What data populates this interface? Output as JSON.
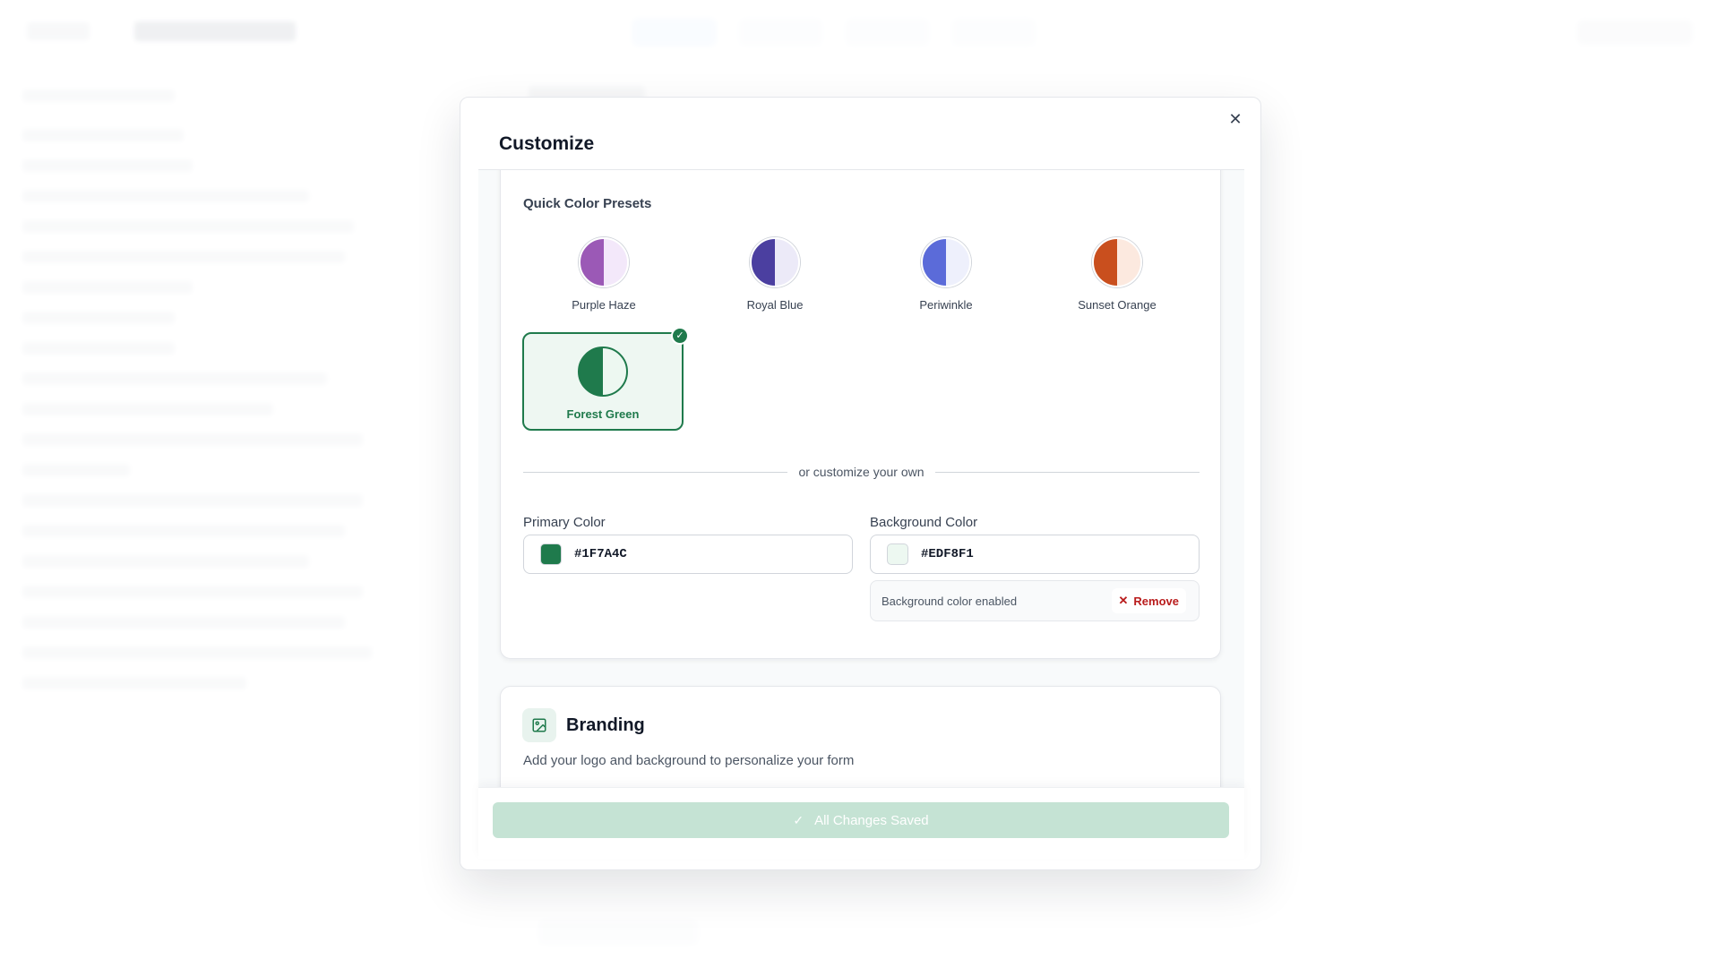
{
  "modal": {
    "title": "Customize",
    "close_icon": "close-icon",
    "colors": {
      "presets_heading": "Quick Color Presets",
      "presets": [
        {
          "name": "Purple Haze",
          "primary": "#9B59B6",
          "background": "#F3E8FA"
        },
        {
          "name": "Royal Blue",
          "primary": "#4B3FA0",
          "background": "#ECEAF8"
        },
        {
          "name": "Periwinkle",
          "primary": "#5B6BD9",
          "background": "#EEF0FC"
        },
        {
          "name": "Sunset Orange",
          "primary": "#C94F1E",
          "background": "#FCE9DF"
        },
        {
          "name": "Forest Green",
          "primary": "#1F7A4C",
          "background": "#EDF8F1",
          "selected": true
        }
      ],
      "divider_text": "or customize your own",
      "primary_label": "Primary Color",
      "primary_value": "#1F7A4C",
      "background_label": "Background Color",
      "background_value": "#EDF8F1",
      "background_status": "Background color enabled",
      "remove_label": "Remove"
    },
    "branding": {
      "title": "Branding",
      "description": "Add your logo and background to personalize your form",
      "icon": "image-icon"
    },
    "footer": {
      "save_label": "All Changes Saved",
      "save_icon": "check-icon"
    }
  }
}
